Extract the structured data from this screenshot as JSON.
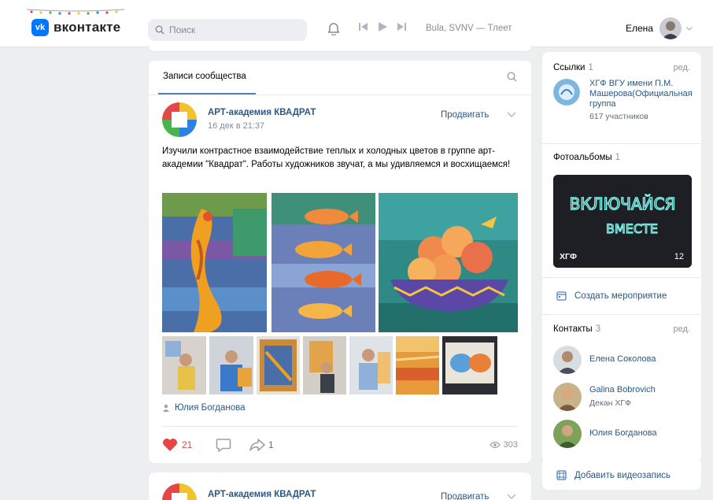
{
  "header": {
    "logo_text": "вконтакте",
    "logo_mark": "vk",
    "search_placeholder": "Поиск",
    "track": "Bula, SVNV — Тлеет",
    "user_name": "Елена"
  },
  "feed": {
    "tab_label": "Записи сообщества",
    "post": {
      "community": "АРТ-академия КВАДРАТ",
      "date": "16 дек в 21:37",
      "promote_label": "Продвигать",
      "text": "Изучили контрастное взаимодействие теплых и холодных цветов в группе арт-академии \"Квадрат\". Работы художников звучат, а мы удивляемся и восхищаемся!",
      "author": "Юлия Богданова",
      "likes": "21",
      "shares": "1",
      "views": "303"
    },
    "post2": {
      "community": "АРТ-академия КВАДРАТ",
      "promote_label": "Продвигать"
    }
  },
  "sidebar": {
    "links": {
      "title": "Ссылки",
      "count": "1",
      "edit": "ред.",
      "item_name": "ХГФ ВГУ имени П.М. Машерова(Официальная группа",
      "item_sub": "617 участников"
    },
    "albums": {
      "title": "Фотоальбомы",
      "count": "1",
      "caption": "ХГФ",
      "photo_count": "12",
      "neon_line1": "ВКЛЮЧАЙСЯ",
      "neon_line2": "ВМЕСТЕ"
    },
    "create_event": "Создать мероприятие",
    "contacts": {
      "title": "Контакты",
      "count": "3",
      "edit": "ред.",
      "items": [
        {
          "name": "Елена Соколова",
          "role": ""
        },
        {
          "name": "Galina Bobrovich",
          "role": "Декан ХГФ"
        },
        {
          "name": "Юлия Богданова",
          "role": ""
        }
      ]
    },
    "add_video": "Добавить видеозапись"
  },
  "colors": {
    "accent": "#2a5885",
    "vk_blue": "#0077ff",
    "like_red": "#e64646",
    "page_bg": "#edeef0"
  }
}
